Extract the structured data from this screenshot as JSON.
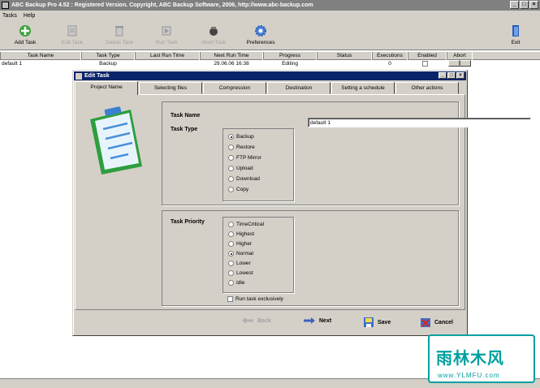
{
  "window": {
    "title": "ABC Backup Pro 4.52 : Registered Version. Copyright, ABC Backup Software, 2006, http://www.abc-backup.com"
  },
  "menu": [
    "Tasks",
    "Help"
  ],
  "toolbar": {
    "add_task": "Add Task",
    "edit_task": "Edit Task",
    "delete_task": "Delete Task",
    "run_task": "Run Task",
    "abort_task": "Abort Task",
    "preferences": "Preferences",
    "exit": "Exit"
  },
  "grid": {
    "columns": [
      "Task Name",
      "Task Type",
      "Last Run Time",
      "Next Run Time",
      "Progress",
      "Status",
      "Executions",
      "Enabled",
      "Abort"
    ],
    "rows": [
      {
        "task_name": "default 1",
        "task_type": "Backup",
        "last_run": "",
        "next_run": "29.06.06 16:38",
        "progress": "Editing",
        "status": "",
        "executions": "0",
        "enabled": "",
        "abort": "||"
      }
    ]
  },
  "dialog": {
    "title": "Edit Task",
    "tabs": [
      "Project Name",
      "Selecting files",
      "Compression",
      "Destination",
      "Setting a schedule",
      "Other actions"
    ],
    "task_name_label": "Task Name",
    "task_name_value": "default 1",
    "task_type_label": "Task Type",
    "task_types": [
      {
        "label": "Backup",
        "selected": true
      },
      {
        "label": "Restore",
        "selected": false
      },
      {
        "label": "FTP Mirror",
        "selected": false
      },
      {
        "label": "Upload",
        "selected": false
      },
      {
        "label": "Download",
        "selected": false
      },
      {
        "label": "Copy",
        "selected": false
      }
    ],
    "priority_label": "Task Priority",
    "priorities": [
      {
        "label": "TimeCritical",
        "selected": false
      },
      {
        "label": "Highest",
        "selected": false
      },
      {
        "label": "Higher",
        "selected": false
      },
      {
        "label": "Normal",
        "selected": true
      },
      {
        "label": "Lower",
        "selected": false
      },
      {
        "label": "Lowest",
        "selected": false
      },
      {
        "label": "Idle",
        "selected": false
      }
    ],
    "run_exclusive_label": "Run task exclusively",
    "buttons": {
      "back": "Back",
      "next": "Next",
      "save": "Save",
      "cancel": "Cancel"
    }
  },
  "watermark": {
    "line1": "雨林木风",
    "line2": "www.YLMFU.com"
  }
}
